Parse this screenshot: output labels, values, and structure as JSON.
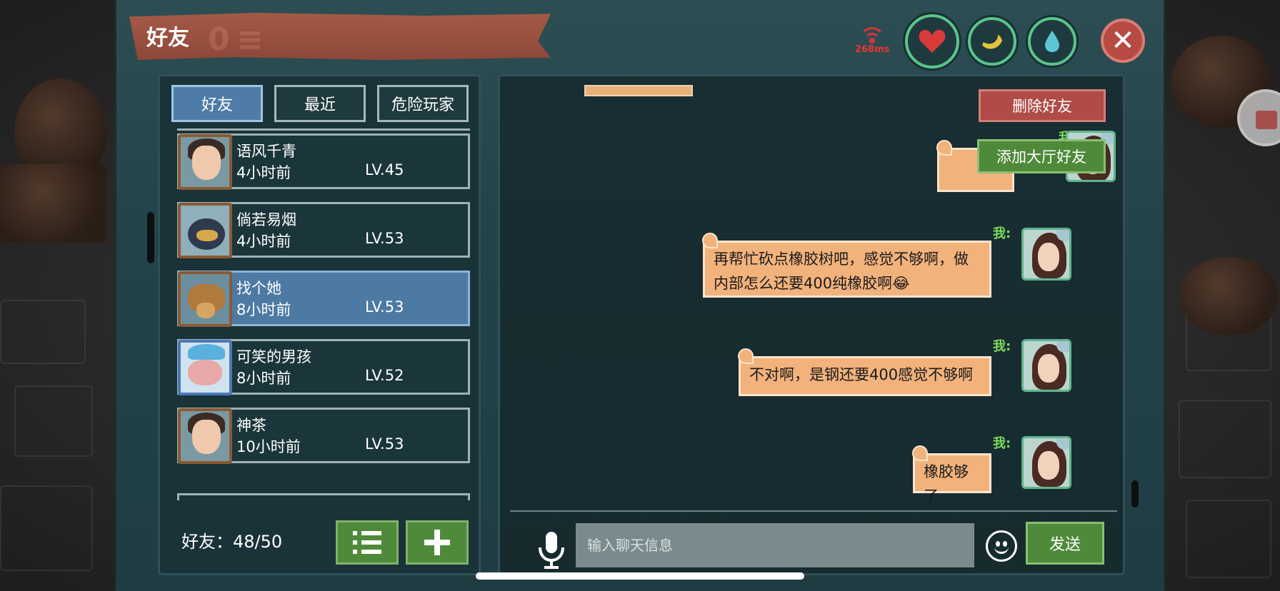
{
  "header": {
    "title": "好友"
  },
  "status": {
    "ping": "268ms",
    "icons": [
      "heart-icon",
      "banana-icon",
      "water-drop-icon"
    ],
    "close_icon": "close-icon"
  },
  "tabs": [
    {
      "label": "好友",
      "active": true
    },
    {
      "label": "最近",
      "active": false
    },
    {
      "label": "危险玩家",
      "active": false
    }
  ],
  "friends": [
    {
      "name": "语风千青",
      "time": "4小时前",
      "level": "LV.45",
      "selected": false
    },
    {
      "name": "倘若易烟",
      "time": "4小时前",
      "level": "LV.53",
      "selected": false
    },
    {
      "name": "找个她",
      "time": "8小时前",
      "level": "LV.53",
      "selected": true
    },
    {
      "name": "可笑的男孩",
      "time": "8小时前",
      "level": "LV.52",
      "selected": false
    },
    {
      "name": "神茶",
      "time": "10小时前",
      "level": "LV.53",
      "selected": false
    }
  ],
  "footer": {
    "count_label": "好友：48/50",
    "list_icon": "list-icon",
    "add_icon": "plus-icon"
  },
  "chat": {
    "delete_friend": "删除好友",
    "add_lobby_friend": "添加大厅好友",
    "messages": [
      {
        "sender": "我:",
        "text": ""
      },
      {
        "sender": "我:",
        "text": "再帮忙砍点橡胶树吧，感觉不够啊，做内部怎么还要400纯橡胶啊😂"
      },
      {
        "sender": "我:",
        "text": "不对啊，是钢还要400感觉不够啊"
      },
      {
        "sender": "我:",
        "text": "橡胶够了"
      }
    ],
    "input_placeholder": "输入聊天信息",
    "send_label": "发送"
  },
  "colors": {
    "panel": "#23434a",
    "green_button": "#4f8a3b",
    "red_button": "#b04b47",
    "bubble": "#f2b27c",
    "selected": "#4d7aa3"
  }
}
